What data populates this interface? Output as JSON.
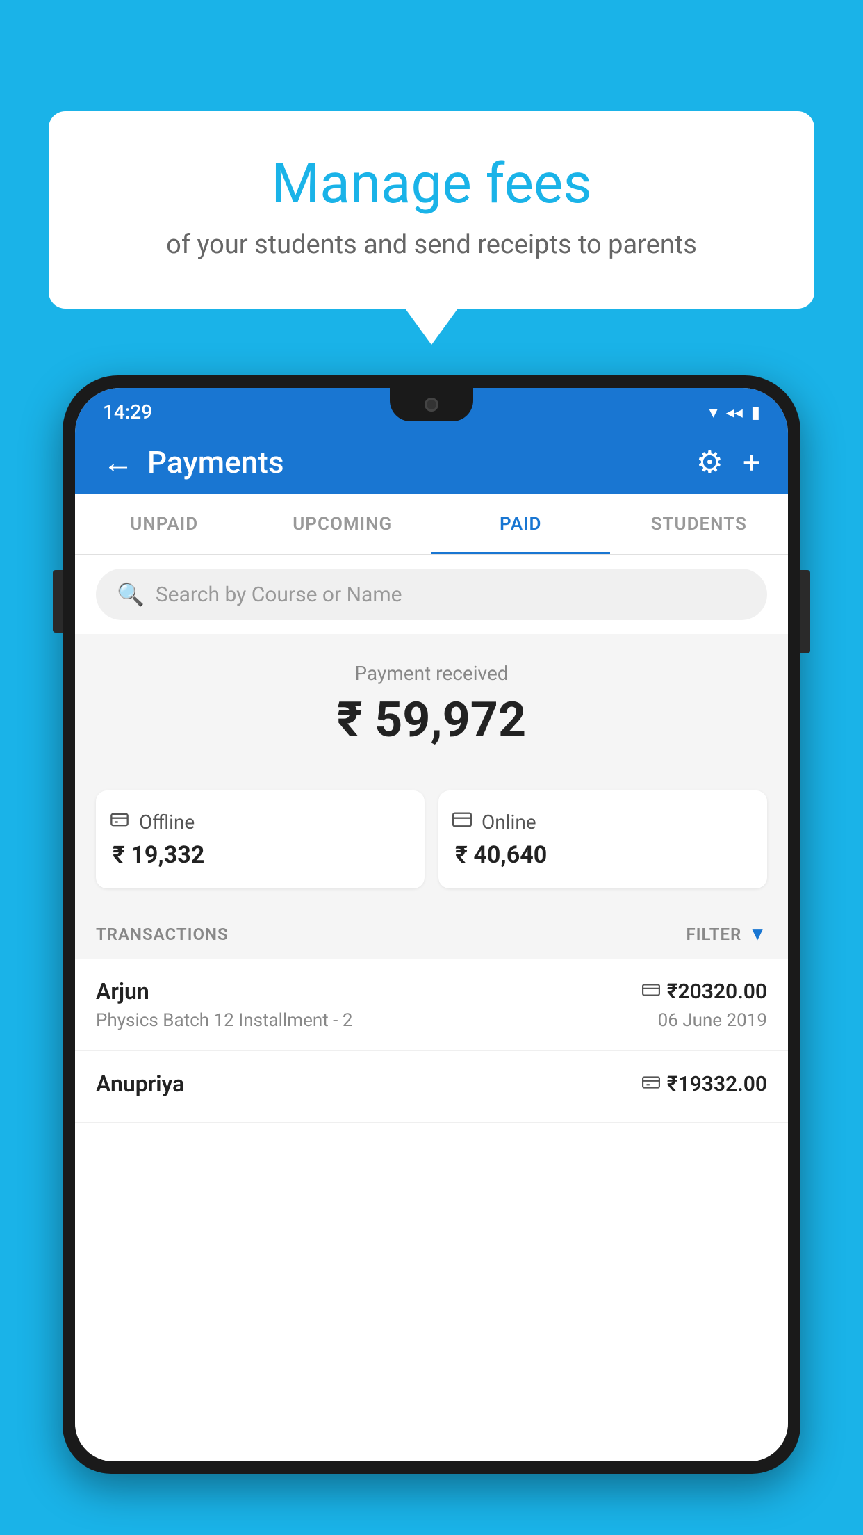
{
  "background_color": "#1ab3e8",
  "bubble": {
    "title": "Manage fees",
    "subtitle": "of your students and send receipts to parents"
  },
  "status_bar": {
    "time": "14:29",
    "wifi": "▾",
    "signal": "▲",
    "battery": "▮"
  },
  "header": {
    "title": "Payments",
    "back_label": "←",
    "gear_label": "⚙",
    "plus_label": "+"
  },
  "tabs": [
    {
      "label": "UNPAID",
      "active": false
    },
    {
      "label": "UPCOMING",
      "active": false
    },
    {
      "label": "PAID",
      "active": true
    },
    {
      "label": "STUDENTS",
      "active": false
    }
  ],
  "search": {
    "placeholder": "Search by Course or Name"
  },
  "payment": {
    "label": "Payment received",
    "amount": "₹ 59,972",
    "offline": {
      "type": "Offline",
      "amount": "₹ 19,332"
    },
    "online": {
      "type": "Online",
      "amount": "₹ 40,640"
    }
  },
  "transactions_label": "TRANSACTIONS",
  "filter_label": "FILTER",
  "transactions": [
    {
      "name": "Arjun",
      "course": "Physics Batch 12 Installment - 2",
      "amount": "₹20320.00",
      "date": "06 June 2019",
      "type_icon": "card"
    },
    {
      "name": "Anupriya",
      "course": "",
      "amount": "₹19332.00",
      "date": "",
      "type_icon": "cash"
    }
  ]
}
